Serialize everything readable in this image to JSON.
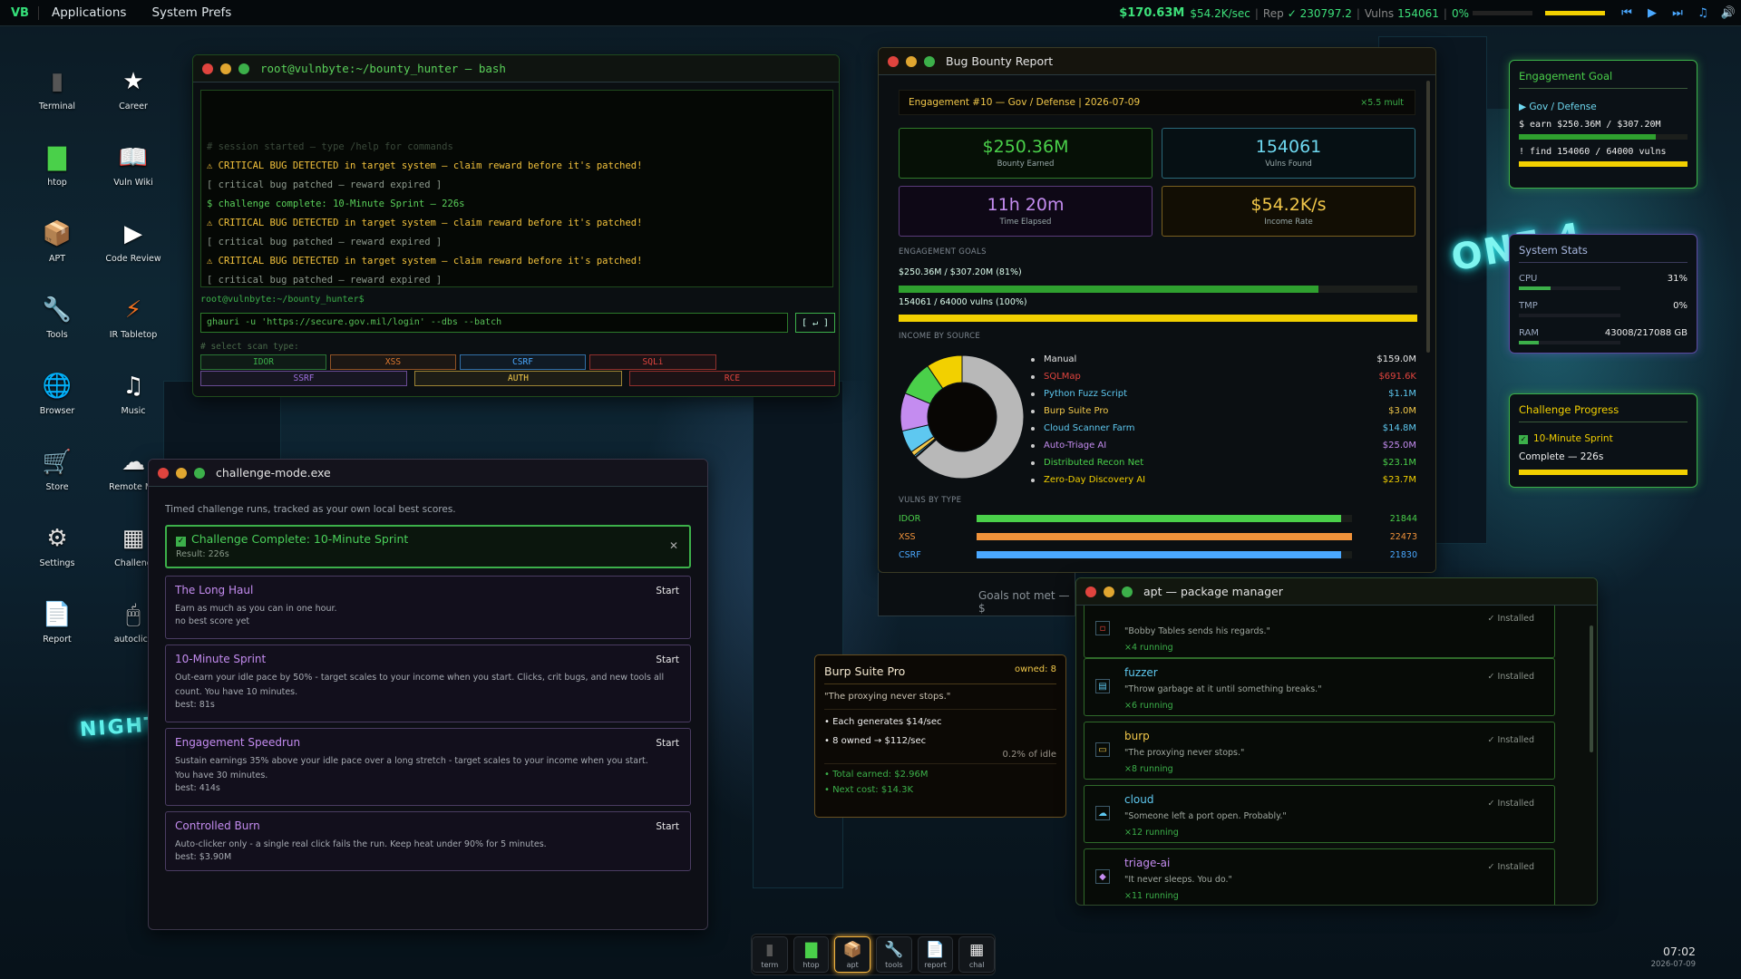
{
  "topbar": {
    "logo": "VB",
    "menus": [
      "Applications",
      "System Prefs"
    ],
    "money": "$170.63M",
    "rate": "$54.2K/sec",
    "rep_label": "Rep",
    "rep_value": "✓ 230797.2",
    "vulns_label": "Vulns",
    "vulns_value": "154061",
    "pct": "0%"
  },
  "desktop_icons": [
    {
      "label": "Terminal",
      "icon": "terminal-icon"
    },
    {
      "label": "Career",
      "icon": "star-icon"
    },
    {
      "label": "htop",
      "icon": "chart-icon"
    },
    {
      "label": "Vuln Wiki",
      "icon": "book-icon"
    },
    {
      "label": "APT",
      "icon": "package-icon"
    },
    {
      "label": "Code Review",
      "icon": "play-icon"
    },
    {
      "label": "Tools",
      "icon": "wrench-icon"
    },
    {
      "label": "IR Tabletop",
      "icon": "bolt-icon"
    },
    {
      "label": "Browser",
      "icon": "globe-icon"
    },
    {
      "label": "Music",
      "icon": "music-icon"
    },
    {
      "label": "Store",
      "icon": "cart-icon"
    },
    {
      "label": "Remote Mo",
      "icon": "cloud-icon"
    },
    {
      "label": "Settings",
      "icon": "gear-icon"
    },
    {
      "label": "Challeng",
      "icon": "checker-icon"
    },
    {
      "label": "Report",
      "icon": "document-icon"
    },
    {
      "label": "autoclick",
      "icon": "mouse-icon"
    }
  ],
  "terminal": {
    "title": "root@vulnbyte:~/bounty_hunter — bash",
    "lines": [
      {
        "text": "# session started — type /help for commands",
        "kind": "dim"
      },
      {
        "text": "⚠  CRITICAL BUG DETECTED in target system — claim reward before it's patched!",
        "kind": "warn"
      },
      {
        "text": "[ critical bug patched — reward expired ]",
        "kind": "gray"
      },
      {
        "text": "$ challenge complete: 10-Minute Sprint — 226s",
        "kind": "ok"
      },
      {
        "text": "⚠  CRITICAL BUG DETECTED in target system — claim reward before it's patched!",
        "kind": "warn"
      },
      {
        "text": "[ critical bug patched — reward expired ]",
        "kind": "gray"
      },
      {
        "text": "⚠  CRITICAL BUG DETECTED in target system — claim reward before it's patched!",
        "kind": "warn"
      },
      {
        "text": "[ critical bug patched — reward expired ]",
        "kind": "gray"
      }
    ],
    "prompt": "root@vulnbyte:~/bounty_hunter$",
    "input_value": "ghauri -u 'https://secure.gov.mil/login' --dbs --batch",
    "run_label": "[ ↵ ]",
    "scan_label": "# select scan type:",
    "scan_types": [
      "IDOR",
      "XSS",
      "CSRF",
      "SQLi",
      "SSRF",
      "AUTH",
      "RCE"
    ]
  },
  "report": {
    "title": "Bug Bounty Report",
    "engagement": "Engagement #10  —  Gov / Defense  |  2026-07-09",
    "multiplier": "×5.5 mult",
    "stats": [
      {
        "value": "$250.36M",
        "label": "Bounty Earned"
      },
      {
        "value": "154061",
        "label": "Vulns Found"
      },
      {
        "value": "11h 20m",
        "label": "Time Elapsed"
      },
      {
        "value": "$54.2K/s",
        "label": "Income Rate"
      }
    ],
    "goals_heading": "ENGAGEMENT GOALS",
    "goal1_label": "$250.36M / $307.20M  (81%)",
    "goal1_fraction": 0.81,
    "goal2_label": "154061 / 64000 vulns  (100%)",
    "goal2_fraction": 1.0,
    "income_heading": "INCOME BY SOURCE",
    "sources": [
      {
        "name": "Manual",
        "amount": "$159.0M",
        "color": "#e6e6e6"
      },
      {
        "name": "SQLMap",
        "amount": "$691.6K",
        "color": "#e0443e"
      },
      {
        "name": "Python Fuzz Script",
        "amount": "$1.1M",
        "color": "#5ec8f0"
      },
      {
        "name": "Burp Suite Pro",
        "amount": "$3.0M",
        "color": "#f2c84a"
      },
      {
        "name": "Cloud Scanner Farm",
        "amount": "$14.8M",
        "color": "#5ec8f0"
      },
      {
        "name": "Auto-Triage AI",
        "amount": "$25.0M",
        "color": "#c48cf0"
      },
      {
        "name": "Distributed Recon Net",
        "amount": "$23.1M",
        "color": "#4ad04a"
      },
      {
        "name": "Zero-Day Discovery AI",
        "amount": "$23.7M",
        "color": "#f2d000"
      }
    ],
    "vulns_heading": "VULNS BY TYPE",
    "vulns": [
      {
        "name": "IDOR",
        "value": "21844",
        "fraction": 0.971,
        "color": "#4ad04a"
      },
      {
        "name": "XSS",
        "value": "22473",
        "fraction": 1.0,
        "color": "#f0923a"
      },
      {
        "name": "CSRF",
        "value": "21830",
        "fraction": 0.971,
        "color": "#4aa8ff"
      }
    ],
    "footer_note": "Goals not met — $"
  },
  "challenge": {
    "title": "challenge-mode.exe",
    "subtitle": "Timed challenge runs, tracked as your own local best scores.",
    "complete_title": "Challenge Complete: 10-Minute Sprint",
    "complete_result": "Result: 226s",
    "cards": [
      {
        "title": "The Long Haul",
        "desc": "Earn as much as you can in one hour.",
        "best": "no best score yet",
        "start": "Start"
      },
      {
        "title": "10-Minute Sprint",
        "desc": "Out-earn your idle pace by 50% - target scales to your income when you start. Clicks, crit bugs, and new tools all count. You have 10 minutes.",
        "best": "best: 81s",
        "start": "Start"
      },
      {
        "title": "Engagement Speedrun",
        "desc": "Sustain earnings 35% above your idle pace over a long stretch - target scales to your income when you start. You have 30 minutes.",
        "best": "best: 414s",
        "start": "Start"
      },
      {
        "title": "Controlled Burn",
        "desc": "Auto-clicker only - a single real click fails the run. Keep heat under 90% for 5 minutes.",
        "best": "best: $3.90M",
        "start": "Start"
      }
    ]
  },
  "tooltip": {
    "name": "Burp Suite Pro",
    "owned": "owned: 8",
    "quote": "\"The proxying never stops.\"",
    "line1": "• Each generates $14/sec",
    "line2": "• 8 owned → $112/sec",
    "pct": "0.2% of idle",
    "earned": "• Total earned: $2.96M",
    "next": "• Next cost: $14.3K"
  },
  "apt": {
    "title": "apt — package manager",
    "packages": [
      {
        "name": "",
        "quote": "\"Bobby Tables sends his regards.\"",
        "running": "×4 running",
        "status": "✓ Installed",
        "color": "#e0443e"
      },
      {
        "name": "fuzzer",
        "quote": "\"Throw garbage at it until something breaks.\"",
        "running": "×6 running",
        "status": "✓ Installed",
        "color": "#5ec8f0"
      },
      {
        "name": "burp",
        "quote": "\"The proxying never stops.\"",
        "running": "×8 running",
        "status": "✓ Installed",
        "color": "#f2c84a"
      },
      {
        "name": "cloud",
        "quote": "\"Someone left a port open. Probably.\"",
        "running": "×12 running",
        "status": "✓ Installed",
        "color": "#5ec8f0"
      },
      {
        "name": "triage-ai",
        "quote": "\"It never sleeps. You do.\"",
        "running": "×11 running",
        "status": "✓ Installed",
        "color": "#c48cf0"
      }
    ]
  },
  "engagement_goal": {
    "title": "Engagement Goal",
    "sector": "▶ Gov / Defense",
    "earn": "$  earn    $250.36M / $307.20M",
    "earn_fraction": 0.81,
    "find": "!  find    154060 / 64000 vulns",
    "find_fraction": 1.0
  },
  "system_stats": {
    "title": "System Stats",
    "rows": [
      {
        "label": "CPU",
        "value": "31%",
        "fraction": 0.31
      },
      {
        "label": "TMP",
        "value": "0%",
        "fraction": 0.0
      },
      {
        "label": "RAM",
        "value": "43008/217088 GB",
        "fraction": 0.2
      }
    ]
  },
  "challenge_progress": {
    "title": "Challenge Progress",
    "name": "10-Minute Sprint",
    "status": "Complete — 226s",
    "fraction": 1.0
  },
  "dock": [
    {
      "label": "term",
      "icon": "terminal-icon"
    },
    {
      "label": "htop",
      "icon": "chart-icon"
    },
    {
      "label": "apt",
      "icon": "package-icon"
    },
    {
      "label": "tools",
      "icon": "wrench-icon"
    },
    {
      "label": "report",
      "icon": "document-icon"
    },
    {
      "label": "chal",
      "icon": "checker-icon"
    }
  ],
  "clock": {
    "time": "07:02",
    "date": "2026-07-09"
  }
}
